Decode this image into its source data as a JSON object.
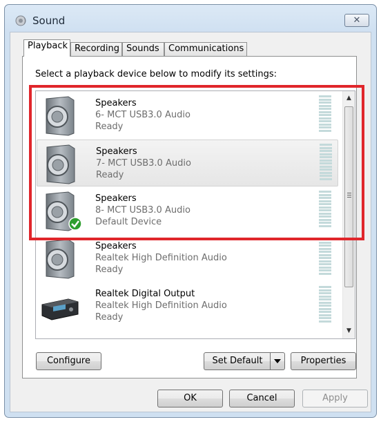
{
  "window": {
    "title": "Sound",
    "close_label": "✕"
  },
  "tabs": [
    {
      "label": "Playback",
      "active": true
    },
    {
      "label": "Recording"
    },
    {
      "label": "Sounds"
    },
    {
      "label": "Communications"
    }
  ],
  "prompt": "Select a playback device below to modify its settings:",
  "devices": [
    {
      "name": "Speakers",
      "description": "6- MCT USB3.0 Audio",
      "status": "Ready",
      "icon": "speaker-icon",
      "selected": false,
      "default": false
    },
    {
      "name": "Speakers",
      "description": "7- MCT USB3.0 Audio",
      "status": "Ready",
      "icon": "speaker-icon",
      "selected": true,
      "default": false
    },
    {
      "name": "Speakers",
      "description": "8- MCT USB3.0 Audio",
      "status": "Default Device",
      "icon": "speaker-icon",
      "selected": false,
      "default": true
    },
    {
      "name": "Speakers",
      "description": "Realtek High Definition Audio",
      "status": "Ready",
      "icon": "speaker-icon",
      "selected": false,
      "default": false
    },
    {
      "name": "Realtek Digital Output",
      "description": "Realtek High Definition Audio",
      "status": "Ready",
      "icon": "receiver-icon",
      "selected": false,
      "default": false
    }
  ],
  "buttons": {
    "configure": "Configure",
    "set_default": "Set Default",
    "properties": "Properties",
    "ok": "OK",
    "cancel": "Cancel",
    "apply": "Apply"
  },
  "colors": {
    "highlight": "#e0262b",
    "default_check": "#2e9e2e"
  }
}
